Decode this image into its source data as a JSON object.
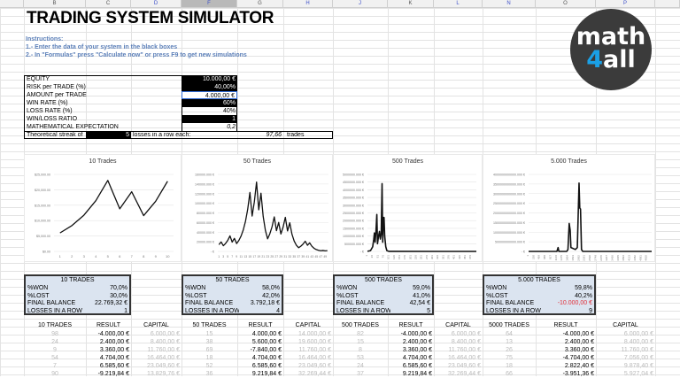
{
  "sheet": {
    "columns": [
      "B",
      "C",
      "D",
      "F",
      "G",
      "H",
      "J",
      "K",
      "L",
      "N",
      "O",
      "P"
    ],
    "selected_column": "F",
    "title": "TRADING SYSTEM SIMULATOR",
    "instructions": [
      "Instructions:",
      "1.- Enter the data of your system in the black boxes",
      "2.- In \"Formulas\" press \"Calculate now\" or press F9 to get new simulations"
    ]
  },
  "logo": {
    "text_top": "math",
    "text_num": "4",
    "text_bottom": "all",
    "circle_color": "#3b3b3b",
    "accent": "#1aa0e6"
  },
  "inputs": [
    {
      "label": "EQUITY",
      "value": "10.000,00 €",
      "style": "black"
    },
    {
      "label": "RISK per TRADE (%)",
      "value": "40,00%",
      "style": "black"
    },
    {
      "label": " AMOUNT per TRADE",
      "value": "4.000,00 €",
      "style": "selected"
    },
    {
      "label": " WIN RATE (%)",
      "value": "60%",
      "style": "black"
    },
    {
      "label": " LOSS RATE (%)",
      "value": "40%",
      "style": "white"
    },
    {
      "label": "WIN/LOSS RATIO",
      "value": "1",
      "style": "black"
    },
    {
      "label": "MATHEMATICAL EXPECTATION",
      "value": "0,2",
      "style": "italic"
    }
  ],
  "streak": {
    "label": "Theoretical streak of",
    "count": "5",
    "text": "losses in a row each:",
    "trades": "97,66",
    "trades_unit": "trades"
  },
  "chart_data": [
    {
      "type": "line",
      "title": "10 Trades",
      "x": [
        1,
        2,
        3,
        4,
        5,
        6,
        7,
        8,
        9,
        10
      ],
      "values": [
        6000,
        8400,
        11760,
        16464,
        23049.6,
        13829.76,
        19361.66,
        11617,
        16263.8,
        22769.32
      ],
      "ylim": [
        0,
        25000
      ],
      "yticks": [
        "$0.00",
        "$5,000.00",
        "$10,000.00",
        "$15,000.00",
        "$20,000.00",
        "$25,000.00"
      ],
      "ytick_values": [
        0,
        5000,
        10000,
        15000,
        20000,
        25000
      ],
      "xtick_step": 1,
      "grid": true
    },
    {
      "type": "line",
      "title": "50 Trades",
      "x_range": [
        1,
        50
      ],
      "values": [
        14000,
        19600,
        11760,
        16464,
        23050,
        32270,
        19360,
        27100,
        16260,
        22770,
        31880,
        44630,
        62480,
        87480,
        122470,
        73480,
        102870,
        144020,
        86410,
        120980,
        72590,
        43550,
        26130,
        36580,
        51210,
        71700,
        43020,
        60220,
        36130,
        50590,
        70820,
        42490,
        59490,
        35690,
        21420,
        12850,
        7710,
        10790,
        15110,
        21150,
        12690,
        17770,
        10660,
        6400,
        3840,
        2300,
        1380,
        1930,
        1160,
        1620
      ],
      "ylim": [
        0,
        160000
      ],
      "yticks": [
        "- €",
        "20000.000 €",
        "40000.000 €",
        "60000.000 €",
        "80000.000 €",
        "100000.000 €",
        "120000.000 €",
        "140000.000 €",
        "160000.000 €"
      ],
      "ytick_values": [
        0,
        20000,
        40000,
        60000,
        80000,
        100000,
        120000,
        140000,
        160000
      ],
      "xtick_step": 2,
      "grid": true
    },
    {
      "type": "line",
      "title": "500 Trades",
      "x_range": [
        1,
        500
      ],
      "points": [
        [
          1,
          6000
        ],
        [
          15,
          50000
        ],
        [
          25,
          300000
        ],
        [
          30,
          800000
        ],
        [
          33,
          1200000
        ],
        [
          36,
          600000
        ],
        [
          40,
          1300000
        ],
        [
          44,
          2400000
        ],
        [
          47,
          500000
        ],
        [
          52,
          1000000
        ],
        [
          56,
          1300000
        ],
        [
          60,
          800000
        ],
        [
          64,
          1100000
        ],
        [
          68,
          4400000
        ],
        [
          71,
          600000
        ],
        [
          74,
          2200000
        ],
        [
          77,
          2200000
        ],
        [
          80,
          1000000
        ],
        [
          85,
          300000
        ],
        [
          90,
          50000
        ],
        [
          100,
          2000
        ],
        [
          500,
          100
        ]
      ],
      "ylim": [
        0,
        5000000
      ],
      "yticks": [
        "- €",
        "500000.000 €",
        "1000000.000 €",
        "1500000.000 €",
        "2000000.000 €",
        "2500000.000 €",
        "3000000.000 €",
        "3500000.000 €",
        "4000000.000 €",
        "4500000.000 €",
        "5000000.000 €"
      ],
      "ytick_values": [
        0,
        500000,
        1000000,
        1500000,
        2000000,
        2500000,
        3000000,
        3500000,
        4000000,
        4500000,
        5000000
      ],
      "xtick_step": 25,
      "grid": true
    },
    {
      "type": "line",
      "title": "5.000 Trades",
      "x_range": [
        1,
        5000
      ],
      "points": [
        [
          1,
          6000
        ],
        [
          1150,
          0
        ],
        [
          1200,
          200000000000
        ],
        [
          1230,
          0
        ],
        [
          1550,
          0
        ],
        [
          1600,
          100000000000
        ],
        [
          1650,
          1450000000000
        ],
        [
          1690,
          1100000000000
        ],
        [
          1720,
          200000000000
        ],
        [
          1900,
          100000000000
        ],
        [
          1980,
          200000000000
        ],
        [
          2050,
          3550000000000
        ],
        [
          2080,
          2250000000000
        ],
        [
          2110,
          2200000000000
        ],
        [
          2150,
          100000000000
        ],
        [
          2200,
          0
        ],
        [
          5000,
          0
        ]
      ],
      "ylim": [
        0,
        4000000000000
      ],
      "yticks": [
        "- €",
        "500000000000.000 €",
        "1000000000000.000 €",
        "1500000000000.000 €",
        "2000000000000.000 €",
        "2500000000000.000 €",
        "3000000000000.000 €",
        "3500000000000.000 €",
        "4000000000000.000 €"
      ],
      "ytick_values": [
        0,
        500000000000,
        1000000000000,
        1500000000000,
        2000000000000,
        2500000000000,
        3000000000000,
        3500000000000,
        4000000000000
      ],
      "xtick_step": 229,
      "grid": true
    }
  ],
  "summaries": [
    {
      "title": "10 TRADES",
      "won_label": "%WON",
      "won": "70,0%",
      "lost_label": "%LOST",
      "lost": "30,0%",
      "balance_label": "FINAL BALANCE",
      "balance": "22.769,32 €",
      "streak_label": "LOSSES IN A ROW",
      "streak": "1"
    },
    {
      "title": "50 TRADES",
      "won_label": "%WON",
      "won": "58,0%",
      "lost_label": "%LOST",
      "lost": "42,0%",
      "balance_label": "FINAL BALANCE",
      "balance": "3.792,18 €",
      "streak_label": "LOSSES IN A ROW",
      "streak": "4"
    },
    {
      "title": "500 TRADES",
      "won_label": "%WON",
      "won": "59,0%",
      "lost_label": "%LOST",
      "lost": "41,0%",
      "balance_label": "FINAL BALANCE",
      "balance": "42,54 €",
      "streak_label": "LOSSES IN A ROW",
      "streak": "5"
    },
    {
      "title": "5.000 TRADES",
      "won_label": "%WON",
      "won": "59,8%",
      "lost_label": "%LOST",
      "lost": "40,2%",
      "balance_label": "FINAL BALANCE",
      "balance": "-10.000,00 €",
      "balance_color": "#e0303a",
      "streak_label": "LOSSES IN A ROW",
      "streak": "9"
    }
  ],
  "tables": [
    {
      "headers": [
        "10 TRADES",
        "RESULT",
        "CAPITAL"
      ],
      "rows": [
        [
          "98",
          "-4.000,00 €",
          "6.000,00 €"
        ],
        [
          "24",
          "2.400,00 €",
          "8.400,00 €"
        ],
        [
          "9",
          "3.360,00 €",
          "11.760,00 €"
        ],
        [
          "54",
          "4.704,00 €",
          "16.464,00 €"
        ],
        [
          "7",
          "6.585,60 €",
          "23.049,60 €"
        ],
        [
          "90",
          "-9.219,84 €",
          "13.829,76 €"
        ]
      ]
    },
    {
      "headers": [
        "50 TRADES",
        "RESULT",
        "CAPITAL"
      ],
      "rows": [
        [
          "15",
          "4.000,00 €",
          "14.000,00 €"
        ],
        [
          "38",
          "5.600,00 €",
          "19.600,00 €"
        ],
        [
          "69",
          "-7.840,00 €",
          "11.760,00 €"
        ],
        [
          "18",
          "4.704,00 €",
          "16.464,00 €"
        ],
        [
          "52",
          "6.585,60 €",
          "23.049,60 €"
        ],
        [
          "36",
          "9.219,84 €",
          "32.269,44 €"
        ]
      ]
    },
    {
      "headers": [
        "500 TRADES",
        "RESULT",
        "CAPITAL"
      ],
      "rows": [
        [
          "82",
          "-4.000,00 €",
          "6.000,00 €"
        ],
        [
          "15",
          "2.400,00 €",
          "8.400,00 €"
        ],
        [
          "8",
          "3.360,00 €",
          "11.760,00 €"
        ],
        [
          "53",
          "4.704,00 €",
          "16.464,00 €"
        ],
        [
          "24",
          "6.585,60 €",
          "23.049,60 €"
        ],
        [
          "37",
          "9.219,84 €",
          "32.269,44 €"
        ]
      ]
    },
    {
      "headers": [
        "5000 TRADES",
        "RESULT",
        "CAPITAL"
      ],
      "rows": [
        [
          "64",
          "-4.000,00 €",
          "6.000,00 €"
        ],
        [
          "13",
          "2.400,00 €",
          "8.400,00 €"
        ],
        [
          "26",
          "3.360,00 €",
          "11.760,00 €"
        ],
        [
          "75",
          "-4.704,00 €",
          "7.056,00 €"
        ],
        [
          "18",
          "2.822,40 €",
          "9.878,40 €"
        ],
        [
          "66",
          "-3.951,36 €",
          "5.927,04 €"
        ]
      ]
    }
  ]
}
